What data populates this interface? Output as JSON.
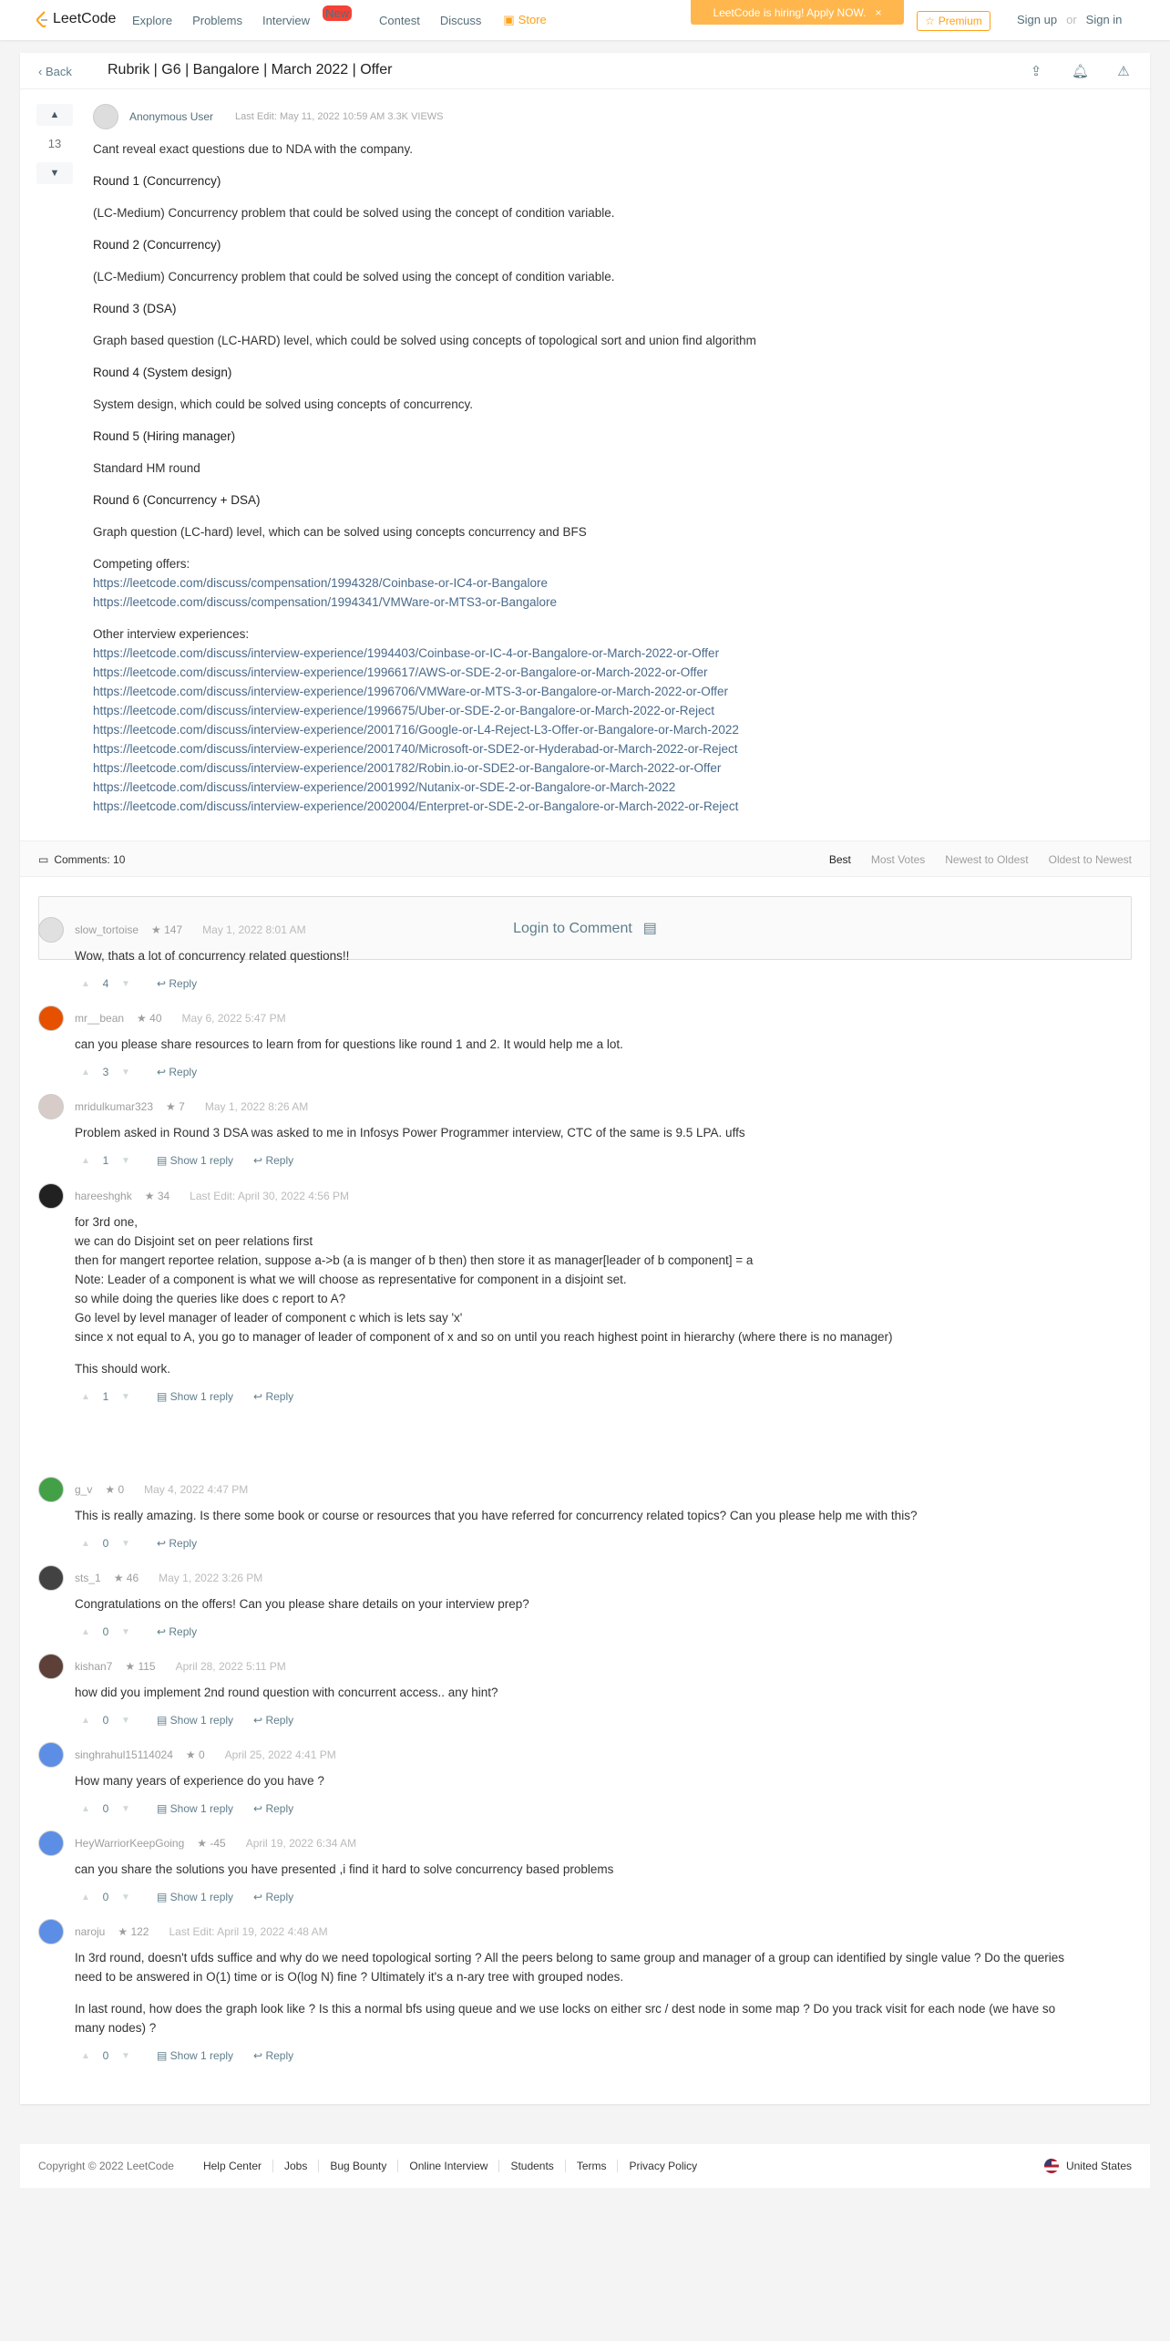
{
  "nav": {
    "logo": "LeetCode",
    "items": [
      "Explore",
      "Problems",
      "Interview",
      "Contest",
      "Discuss"
    ],
    "new_badge": "New",
    "store": "Store",
    "hiring": "LeetCode is hiring! Apply NOW.",
    "premium": "Premium",
    "signup": "Sign up",
    "or": "or",
    "signin": "Sign in"
  },
  "topic": {
    "back": "Back",
    "title": "Rubrik | G6 | Bangalore | March 2022 | Offer",
    "votes": "13",
    "author": "Anonymous User",
    "meta": "Last Edit: May 11, 2022 10:59 AM   3.3K VIEWS",
    "lines": [
      "Cant reveal exact questions due to NDA with the company.",
      "Round 1 (Concurrency)",
      "(LC-Medium) Concurrency problem that could be solved using the concept of condition variable.",
      "Round 2 (Concurrency)",
      "(LC-Medium) Concurrency problem that could be solved using the concept of condition variable.",
      "Round 3 (DSA)",
      "Graph based question (LC-HARD) level, which could be solved using concepts of topological sort and union find algorithm",
      "Round 4 (System design)",
      "System design, which could be solved using concepts of concurrency.",
      "Round 5 (Hiring manager)",
      "Standard HM round",
      "Round 6 (Concurrency + DSA)",
      "Graph question (LC-hard) level, which can be solved using concepts concurrency and BFS",
      "Competing offers:"
    ],
    "competing": [
      "https://leetcode.com/discuss/compensation/1994328/Coinbase-or-IC4-or-Bangalore",
      "https://leetcode.com/discuss/compensation/1994341/VMWare-or-MTS3-or-Bangalore"
    ],
    "other_label": "Other interview experiences:",
    "other": [
      "https://leetcode.com/discuss/interview-experience/1994403/Coinbase-or-IC-4-or-Bangalore-or-March-2022-or-Offer",
      "https://leetcode.com/discuss/interview-experience/1996617/AWS-or-SDE-2-or-Bangalore-or-March-2022-or-Offer",
      "https://leetcode.com/discuss/interview-experience/1996706/VMWare-or-MTS-3-or-Bangalore-or-March-2022-or-Offer",
      "https://leetcode.com/discuss/interview-experience/1996675/Uber-or-SDE-2-or-Bangalore-or-March-2022-or-Reject",
      "https://leetcode.com/discuss/interview-experience/2001716/Google-or-L4-Reject-L3-Offer-or-Bangalore-or-March-2022",
      "https://leetcode.com/discuss/interview-experience/2001740/Microsoft-or-SDE2-or-Hyderabad-or-March-2022-or-Reject",
      "https://leetcode.com/discuss/interview-experience/2001782/Robin.io-or-SDE2-or-Bangalore-or-March-2022-or-Offer",
      "https://leetcode.com/discuss/interview-experience/2001992/Nutanix-or-SDE-2-or-Bangalore-or-March-2022",
      "https://leetcode.com/discuss/interview-experience/2002004/Enterpret-or-SDE-2-or-Bangalore-or-March-2022-or-Reject"
    ]
  },
  "comments_bar": {
    "count": "Comments: 10",
    "sorts": [
      "Best",
      "Most Votes",
      "Newest to Oldest",
      "Oldest to Newest"
    ]
  },
  "login": "Login to Comment",
  "comments": [
    {
      "user": "slow_tortoise",
      "rep": "147",
      "date": "May 1, 2022 8:01 AM",
      "text": [
        "Wow, thats a lot of concurrency related questions!!"
      ],
      "votes": "4",
      "show": "",
      "reply": "Reply",
      "color": "#e0e0e0"
    },
    {
      "user": "mr__bean",
      "rep": "40",
      "date": "May 6, 2022 5:47 PM",
      "text": [
        "can you please share resources to learn from for questions like round 1 and 2. It would help me a lot."
      ],
      "votes": "3",
      "show": "",
      "reply": "Reply",
      "color": "#e65100"
    },
    {
      "user": "mridulkumar323",
      "rep": "7",
      "date": "May 1, 2022 8:26 AM",
      "text": [
        "Problem asked in Round 3 DSA was asked to me in Infosys Power Programmer interview, CTC of the same is 9.5 LPA. uffs"
      ],
      "votes": "1",
      "show": "Show 1 reply",
      "reply": "Reply",
      "color": "#d7ccc8"
    },
    {
      "user": "hareeshghk",
      "rep": "34",
      "date": "Last Edit: April 30, 2022 4:56 PM",
      "text": [
        "for 3rd one,",
        "we can do Disjoint set on peer relations first",
        "then for mangert reportee relation, suppose a->b (a is manger of b then) then store it as manager[leader of b component] = a",
        "Note: Leader of a component is what we will choose as representative for component in a disjoint set.",
        "so while doing the queries like does c report to A?",
        "Go level by level manager of leader of component c which is lets say 'x'",
        "since x not equal to A, you go to manager of leader of component of x and so on until you reach highest point in hierarchy (where there is no manager)",
        "",
        "This should work."
      ],
      "votes": "1",
      "show": "Show 1 reply",
      "reply": "Reply",
      "color": "#212121"
    },
    {
      "user": "g_v",
      "rep": "0",
      "date": "May 4, 2022 4:47 PM",
      "text": [
        "This is really amazing. Is there some book or course or resources that you have referred for concurrency related topics? Can you please help me with this?"
      ],
      "votes": "0",
      "show": "",
      "reply": "Reply",
      "color": "#43a047"
    },
    {
      "user": "sts_1",
      "rep": "46",
      "date": "May 1, 2022 3:26 PM",
      "text": [
        "Congratulations on the offers! Can you please share details on your interview prep?"
      ],
      "votes": "0",
      "show": "",
      "reply": "Reply",
      "color": "#424242"
    },
    {
      "user": "kishan7",
      "rep": "115",
      "date": "April 28, 2022 5:11 PM",
      "text": [
        "how did you implement 2nd round question with concurrent access.. any hint?"
      ],
      "votes": "0",
      "show": "Show 1 reply",
      "reply": "Reply",
      "color": "#5d4037"
    },
    {
      "user": "singhrahul15114024",
      "rep": "0",
      "date": "April 25, 2022 4:41 PM",
      "text": [
        "How many years of experience do you have ?"
      ],
      "votes": "0",
      "show": "Show 1 reply",
      "reply": "Reply",
      "color": "#5c8ee6"
    },
    {
      "user": "HeyWarriorKeepGoing",
      "rep": "-45",
      "date": "April 19, 2022 6:34 AM",
      "text": [
        "can you share the solutions you have presented ,i find it hard to solve concurrency based problems"
      ],
      "votes": "0",
      "show": "Show 1 reply",
      "reply": "Reply",
      "color": "#5c8ee6"
    },
    {
      "user": "naroju",
      "rep": "122",
      "date": "Last Edit: April 19, 2022 4:48 AM",
      "text": [
        "In 3rd round, doesn't ufds suffice and why do we need topological sorting ? All the peers belong to same group and manager of a group can identified by single value ? Do the queries",
        "need to be answered in O(1) time or is O(log N) fine ? Ultimately it's a n-ary tree with grouped nodes.",
        "",
        "In last round, how does the graph look like ? Is this a normal bfs using queue and we use locks on either src / dest node in some map ? Do you track visit for each node (we have so",
        "many nodes) ?"
      ],
      "votes": "0",
      "show": "Show 1 reply",
      "reply": "Reply",
      "color": "#5c8ee6"
    }
  ],
  "footer": {
    "copyright": "Copyright © 2022 LeetCode",
    "links": [
      "Help Center",
      "Jobs",
      "Bug Bounty",
      "Online Interview",
      "Students",
      "Terms",
      "Privacy Policy"
    ],
    "region": "United States"
  }
}
